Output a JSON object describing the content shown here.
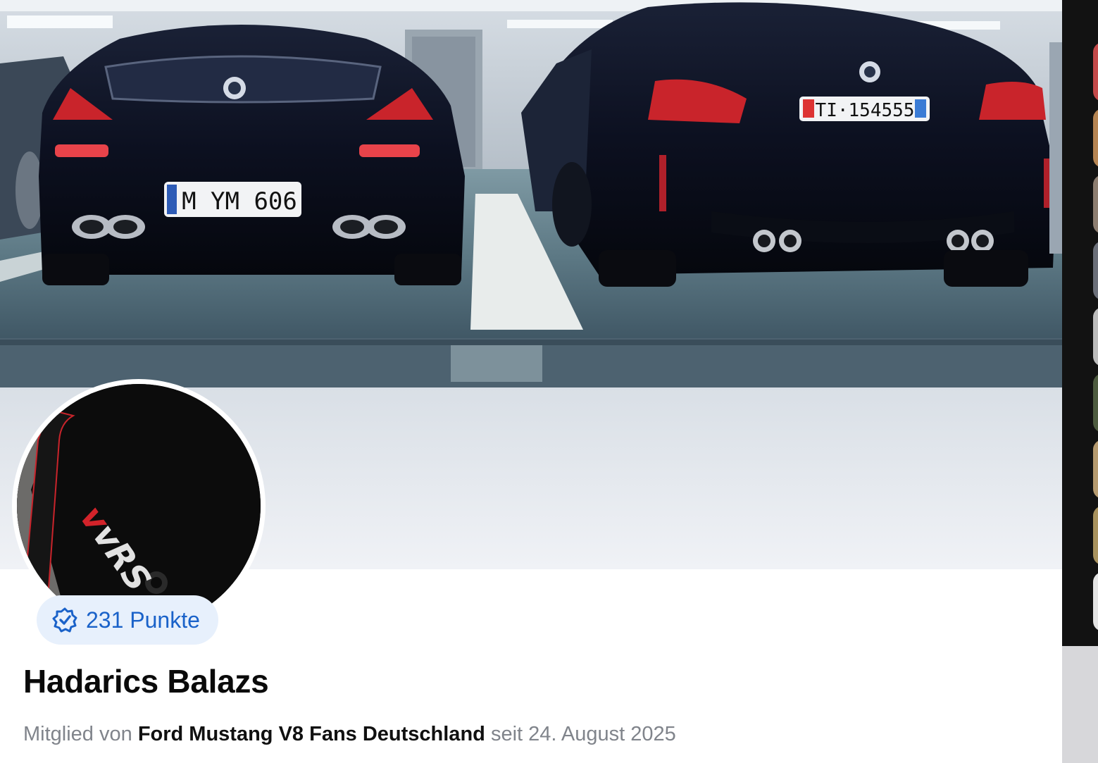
{
  "profile": {
    "points_label": "231 Punkte",
    "name": "Hadarics Balazs",
    "member_prefix": "Mitglied von",
    "group_name": "Ford Mustang V8 Fans Deutschland",
    "member_since": "seit 24. August 2025"
  },
  "cover": {
    "plate_left": "M YM 606",
    "plate_right": "TI·154555"
  },
  "avatar": {
    "logo_text": "vRS"
  },
  "colors": {
    "accent": "#1a62c9",
    "badge_bg": "#e7f0fc",
    "muted_text": "#80848b"
  },
  "icons": {
    "points": "points-badge-icon"
  }
}
